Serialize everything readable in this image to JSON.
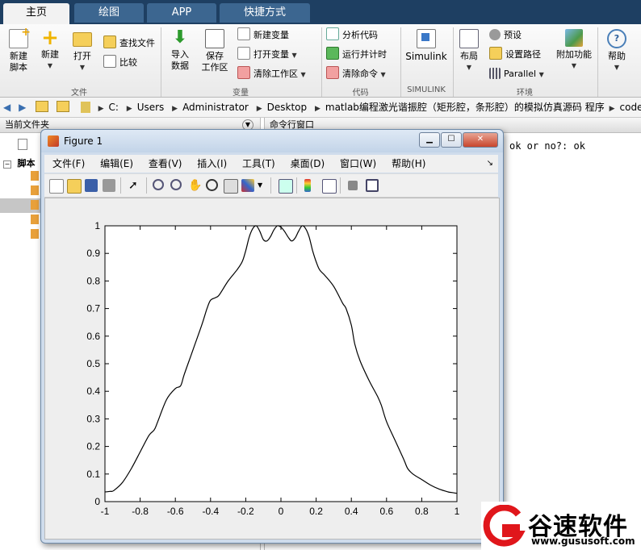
{
  "tabs": [
    {
      "label": "主页",
      "active": true
    },
    {
      "label": "绘图",
      "active": false
    },
    {
      "label": "APP",
      "active": false
    },
    {
      "label": "快捷方式",
      "active": false
    }
  ],
  "ribbon": {
    "file_group": {
      "label": "文件",
      "new_script": "新建\n脚本",
      "new": "新建",
      "open": "打开",
      "find_files": "查找文件",
      "compare": "比较"
    },
    "variable_group": {
      "label": "变量",
      "import_data": "导入\n数据",
      "save_workspace": "保存\n工作区",
      "new_variable": "新建变量",
      "open_variable": "打开变量",
      "clear_workspace": "清除工作区"
    },
    "code_group": {
      "label": "代码",
      "analyze_code": "分析代码",
      "run_and_time": "运行并计时",
      "clear_commands": "清除命令"
    },
    "simulink_group": {
      "label": "SIMULINK",
      "simulink": "Simulink"
    },
    "env_group": {
      "label": "环境",
      "layout": "布局",
      "preferences": "预设",
      "set_path": "设置路径",
      "parallel": "Parallel",
      "addons": "附加功能"
    },
    "help": "帮助"
  },
  "address": {
    "crumbs": [
      "C:",
      "Users",
      "Administrator",
      "Desktop",
      "matlab编程激光谐振腔（矩形腔，条形腔）的模拟仿真源码 程序",
      "code"
    ]
  },
  "file_panel": {
    "title": "当前文件夹",
    "tree_root": "脚本"
  },
  "command_panel": {
    "title": "命令行窗口",
    "output": "ok or no?: ok"
  },
  "figure": {
    "title": "Figure 1",
    "menu": [
      "文件(F)",
      "编辑(E)",
      "查看(V)",
      "插入(I)",
      "工具(T)",
      "桌面(D)",
      "窗口(W)",
      "帮助(H)"
    ]
  },
  "chart_data": {
    "type": "line",
    "title": "",
    "xlabel": "",
    "ylabel": "",
    "xlim": [
      -1,
      1
    ],
    "ylim": [
      0,
      1
    ],
    "xticks": [
      -1,
      -0.8,
      -0.6,
      -0.4,
      -0.2,
      0,
      0.2,
      0.4,
      0.6,
      0.8,
      1
    ],
    "yticks": [
      0,
      0.1,
      0.2,
      0.3,
      0.4,
      0.5,
      0.6,
      0.7,
      0.8,
      0.9,
      1
    ],
    "grid": false,
    "series": [
      {
        "color": "#000000",
        "x": [
          -1.0,
          -0.97,
          -0.95,
          -0.9,
          -0.85,
          -0.8,
          -0.75,
          -0.72,
          -0.7,
          -0.65,
          -0.6,
          -0.57,
          -0.55,
          -0.5,
          -0.45,
          -0.42,
          -0.4,
          -0.37,
          -0.35,
          -0.3,
          -0.25,
          -0.22,
          -0.2,
          -0.18,
          -0.16,
          -0.14,
          -0.12,
          -0.1,
          -0.08,
          -0.06,
          -0.04,
          -0.02,
          0.0,
          0.02,
          0.04,
          0.06,
          0.08,
          0.1,
          0.12,
          0.14,
          0.16,
          0.18,
          0.2,
          0.22,
          0.25,
          0.3,
          0.35,
          0.37,
          0.4,
          0.42,
          0.45,
          0.5,
          0.55,
          0.57,
          0.6,
          0.65,
          0.7,
          0.72,
          0.75,
          0.8,
          0.85,
          0.9,
          0.95,
          0.97,
          1.0
        ],
        "y": [
          0.035,
          0.037,
          0.04,
          0.07,
          0.12,
          0.18,
          0.24,
          0.26,
          0.29,
          0.37,
          0.41,
          0.42,
          0.46,
          0.55,
          0.64,
          0.7,
          0.73,
          0.74,
          0.75,
          0.8,
          0.84,
          0.87,
          0.91,
          0.96,
          0.99,
          1.0,
          0.98,
          0.95,
          0.945,
          0.96,
          0.985,
          1.0,
          0.995,
          0.98,
          0.96,
          0.945,
          0.955,
          0.98,
          1.0,
          0.99,
          0.96,
          0.91,
          0.87,
          0.84,
          0.82,
          0.78,
          0.72,
          0.7,
          0.64,
          0.57,
          0.51,
          0.44,
          0.38,
          0.35,
          0.29,
          0.22,
          0.15,
          0.12,
          0.1,
          0.08,
          0.06,
          0.045,
          0.035,
          0.033,
          0.03
        ]
      }
    ]
  },
  "watermark": {
    "brand": "谷速软件",
    "url": "www.gususoft.com"
  },
  "colors": {
    "tabbar": "#1e3f62",
    "ribbon": "#efefef",
    "figure_frame": "#cfdcec",
    "watermark_red": "#e0161b"
  }
}
